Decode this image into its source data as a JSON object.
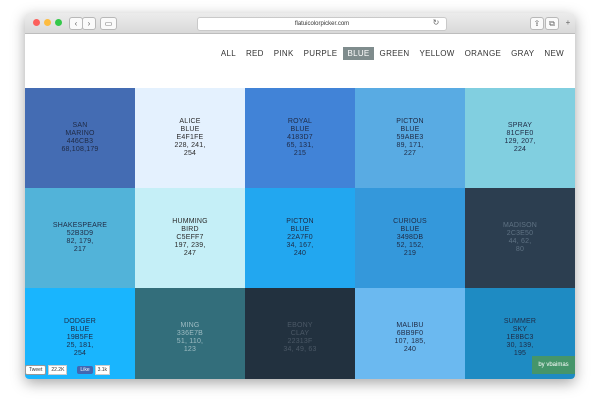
{
  "browser": {
    "url": "flatuicolorpicker.com",
    "back_label": "‹",
    "forward_label": "›",
    "tabs_label": "▭",
    "reload_label": "↻",
    "share_label": "⇪",
    "tabview_label": "⧉",
    "newtab_label": "+"
  },
  "filters": [
    "ALL",
    "RED",
    "PINK",
    "PURPLE",
    "BLUE",
    "GREEN",
    "YELLOW",
    "ORANGE",
    "GRAY",
    "NEW"
  ],
  "active_filter": "BLUE",
  "colors": [
    {
      "name1": "SAN",
      "name2": "MARINO",
      "hex": "446CB3",
      "rgb1": "68,108,179",
      "rgb2": "",
      "bg": "#446cb3",
      "fg": "#1f2a44"
    },
    {
      "name1": "ALICE",
      "name2": "BLUE",
      "hex": "E4F1FE",
      "rgb1": "228, 241,",
      "rgb2": "254",
      "bg": "#e4f1fe",
      "fg": "#2b2b2b"
    },
    {
      "name1": "ROYAL",
      "name2": "BLUE",
      "hex": "4183D7",
      "rgb1": "65, 131,",
      "rgb2": "215",
      "bg": "#4183d7",
      "fg": "#1f2a44"
    },
    {
      "name1": "PICTON",
      "name2": "BLUE",
      "hex": "59ABE3",
      "rgb1": "89, 171,",
      "rgb2": "227",
      "bg": "#59abe3",
      "fg": "#1f2a44"
    },
    {
      "name1": "SPRAY",
      "name2": "",
      "hex": "81CFE0",
      "rgb1": "129, 207,",
      "rgb2": "224",
      "bg": "#81cfe0",
      "fg": "#1f2a44"
    },
    {
      "name1": "SHAKESPEARE",
      "name2": "",
      "hex": "52B3D9",
      "rgb1": "82, 179,",
      "rgb2": "217",
      "bg": "#52b3d9",
      "fg": "#1f2a44"
    },
    {
      "name1": "HUMMING",
      "name2": "BIRD",
      "hex": "C5EFF7",
      "rgb1": "197, 239,",
      "rgb2": "247",
      "bg": "#c5eff7",
      "fg": "#2b2b2b"
    },
    {
      "name1": "PICTON",
      "name2": "BLUE",
      "hex": "22A7F0",
      "rgb1": "34, 167,",
      "rgb2": "240",
      "bg": "#22a7f0",
      "fg": "#1f2a44"
    },
    {
      "name1": "CURIOUS",
      "name2": "BLUE",
      "hex": "3498DB",
      "rgb1": "52, 152,",
      "rgb2": "219",
      "bg": "#3498db",
      "fg": "#1f2a44"
    },
    {
      "name1": "MADISON",
      "name2": "",
      "hex": "2C3E50",
      "rgb1": "44, 62,",
      "rgb2": "80",
      "bg": "#2c3e50",
      "fg": "#5f7283"
    },
    {
      "name1": "DODGER",
      "name2": "BLUE",
      "hex": "19B5FE",
      "rgb1": "25, 181,",
      "rgb2": "254",
      "bg": "#19b5fe",
      "fg": "#1f2a44"
    },
    {
      "name1": "MING",
      "name2": "",
      "hex": "336E7B",
      "rgb1": "51, 110,",
      "rgb2": "123",
      "bg": "#336e7b",
      "fg": "#9ebcc3"
    },
    {
      "name1": "EBONY",
      "name2": "CLAY",
      "hex": "22313F",
      "rgb1": "34, 49, 63",
      "rgb2": "",
      "bg": "#22313f",
      "fg": "#4b5866"
    },
    {
      "name1": "MALIBU",
      "name2": "",
      "hex": "6BB9F0",
      "rgb1": "107, 185,",
      "rgb2": "240",
      "bg": "#6bb9f0",
      "fg": "#1f2a44"
    },
    {
      "name1": "SUMMER",
      "name2": "SKY",
      "hex": "1E8BC3",
      "rgb1": "30, 139,",
      "rgb2": "195",
      "bg": "#1e8bc3",
      "fg": "#1f2a44"
    }
  ],
  "social": {
    "tweet_label": "Tweet",
    "tweet_count": "22.2K",
    "like_label": "Like",
    "like_count": "3.1k"
  },
  "credit": "by vbaimas"
}
